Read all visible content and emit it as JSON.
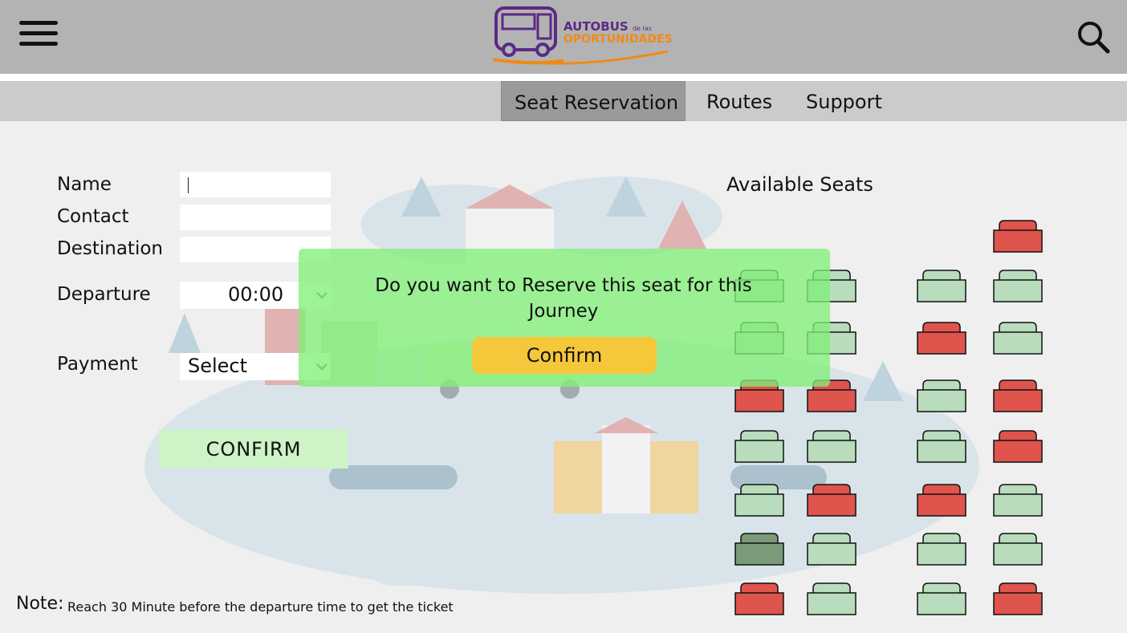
{
  "header": {
    "logo_word": "AUTOBUS",
    "logo_small": "de las",
    "logo_word2": "OPORTUNIDADES"
  },
  "nav": {
    "tabs": [
      {
        "label": "Seat Reservation",
        "active": true
      },
      {
        "label": "Routes",
        "active": false
      },
      {
        "label": "Support",
        "active": false
      }
    ]
  },
  "form": {
    "name_label": "Name",
    "contact_label": "Contact",
    "destination_label": "Destination",
    "departure_label": "Departure",
    "departure_value": "00:00",
    "payment_label": "Payment",
    "payment_value": "Select",
    "confirm_label": "CONFIRM"
  },
  "seats": {
    "title": "Available Seats",
    "colors": {
      "available": "#b8dcbc",
      "reserved": "#e0544e",
      "selected": "#7a9a7a",
      "border": "#111111"
    },
    "layout": [
      [
        "",
        "",
        "",
        "reserved"
      ],
      [
        "available",
        "available",
        "available",
        "available"
      ],
      [
        "available",
        "available",
        "reserved",
        "available"
      ],
      [
        "reserved",
        "reserved",
        "available",
        "reserved"
      ],
      [
        "available",
        "available",
        "available",
        "reserved"
      ],
      [
        "available",
        "reserved",
        "reserved",
        "available"
      ],
      [
        "selected",
        "available",
        "available",
        "available"
      ],
      [
        "reserved",
        "available",
        "available",
        "reserved"
      ]
    ]
  },
  "modal": {
    "message": "Do you want to Reserve this seat for this Journey",
    "confirm_label": "Confirm"
  },
  "note": {
    "label": "Note:",
    "text": "Reach 30 Minute before the departure time to get the ticket"
  }
}
